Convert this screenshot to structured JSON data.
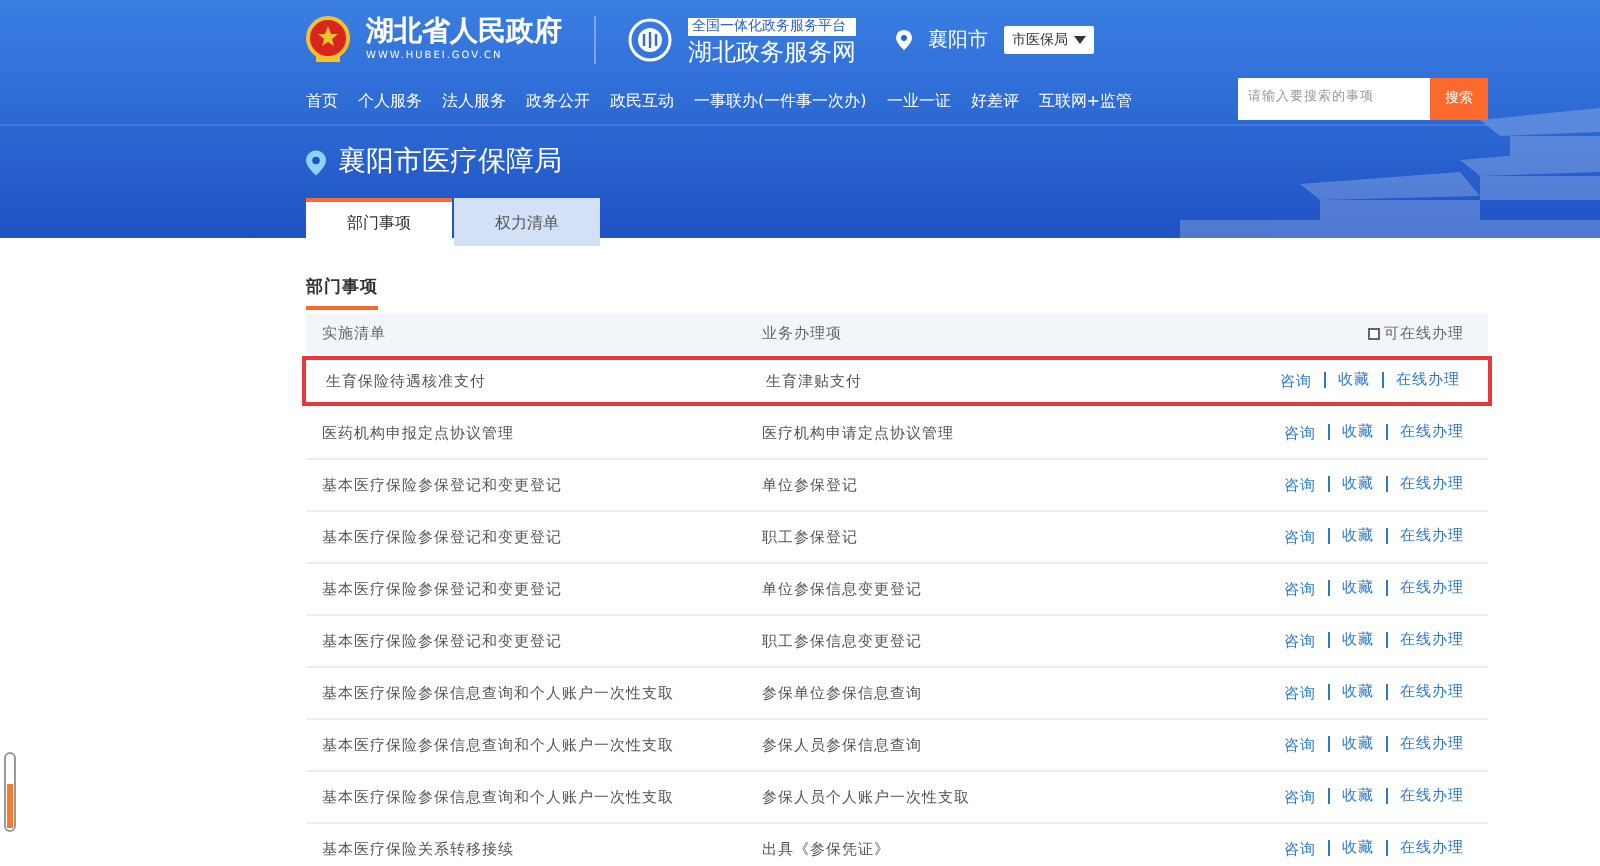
{
  "header": {
    "gov_name": "湖北省人民政府",
    "gov_url": "WWW.HUBEI.GOV.CN",
    "platform_tag": "全国一体化政务服务平台",
    "platform_name": "湖北政务服务网",
    "city": "襄阳市",
    "department_select": "市医保局"
  },
  "nav": [
    "首页",
    "个人服务",
    "法人服务",
    "政务公开",
    "政民互动",
    "一事联办(一件事一次办)",
    "一业一证",
    "好差评",
    "互联网+监管"
  ],
  "search": {
    "placeholder": "请输入要搜索的事项",
    "button": "搜索"
  },
  "page_title": "襄阳市医疗保障局",
  "tabs": [
    {
      "label": "部门事项",
      "selected": true
    },
    {
      "label": "权力清单",
      "selected": false
    }
  ],
  "section_title": "部门事项",
  "table": {
    "columns": [
      "实施清单",
      "业务办理项"
    ],
    "filter": {
      "label": "可在线办理",
      "checked": false
    },
    "rows": [
      {
        "list": "生育保险待遇核准支付",
        "item": "生育津贴支付",
        "highlighted": true,
        "actions": [
          "咨询",
          "收藏",
          "在线办理"
        ]
      },
      {
        "list": "医药机构申报定点协议管理",
        "item": "医疗机构申请定点协议管理",
        "highlighted": false,
        "actions": [
          "咨询",
          "收藏",
          "在线办理"
        ]
      },
      {
        "list": "基本医疗保险参保登记和变更登记",
        "item": "单位参保登记",
        "highlighted": false,
        "actions": [
          "咨询",
          "收藏",
          "在线办理"
        ]
      },
      {
        "list": "基本医疗保险参保登记和变更登记",
        "item": "职工参保登记",
        "highlighted": false,
        "actions": [
          "咨询",
          "收藏",
          "在线办理"
        ]
      },
      {
        "list": "基本医疗保险参保登记和变更登记",
        "item": "单位参保信息变更登记",
        "highlighted": false,
        "actions": [
          "咨询",
          "收藏",
          "在线办理"
        ]
      },
      {
        "list": "基本医疗保险参保登记和变更登记",
        "item": "职工参保信息变更登记",
        "highlighted": false,
        "actions": [
          "咨询",
          "收藏",
          "在线办理"
        ]
      },
      {
        "list": "基本医疗保险参保信息查询和个人账户一次性支取",
        "item": "参保单位参保信息查询",
        "highlighted": false,
        "actions": [
          "咨询",
          "收藏",
          "在线办理"
        ]
      },
      {
        "list": "基本医疗保险参保信息查询和个人账户一次性支取",
        "item": "参保人员参保信息查询",
        "highlighted": false,
        "actions": [
          "咨询",
          "收藏",
          "在线办理"
        ]
      },
      {
        "list": "基本医疗保险参保信息查询和个人账户一次性支取",
        "item": "参保人员个人账户一次性支取",
        "highlighted": false,
        "actions": [
          "咨询",
          "收藏",
          "在线办理"
        ]
      },
      {
        "list": "基本医疗保险关系转移接续",
        "item": "出具《参保凭证》",
        "highlighted": false,
        "actions": [
          "咨询",
          "收藏",
          "在线办理"
        ]
      }
    ]
  }
}
